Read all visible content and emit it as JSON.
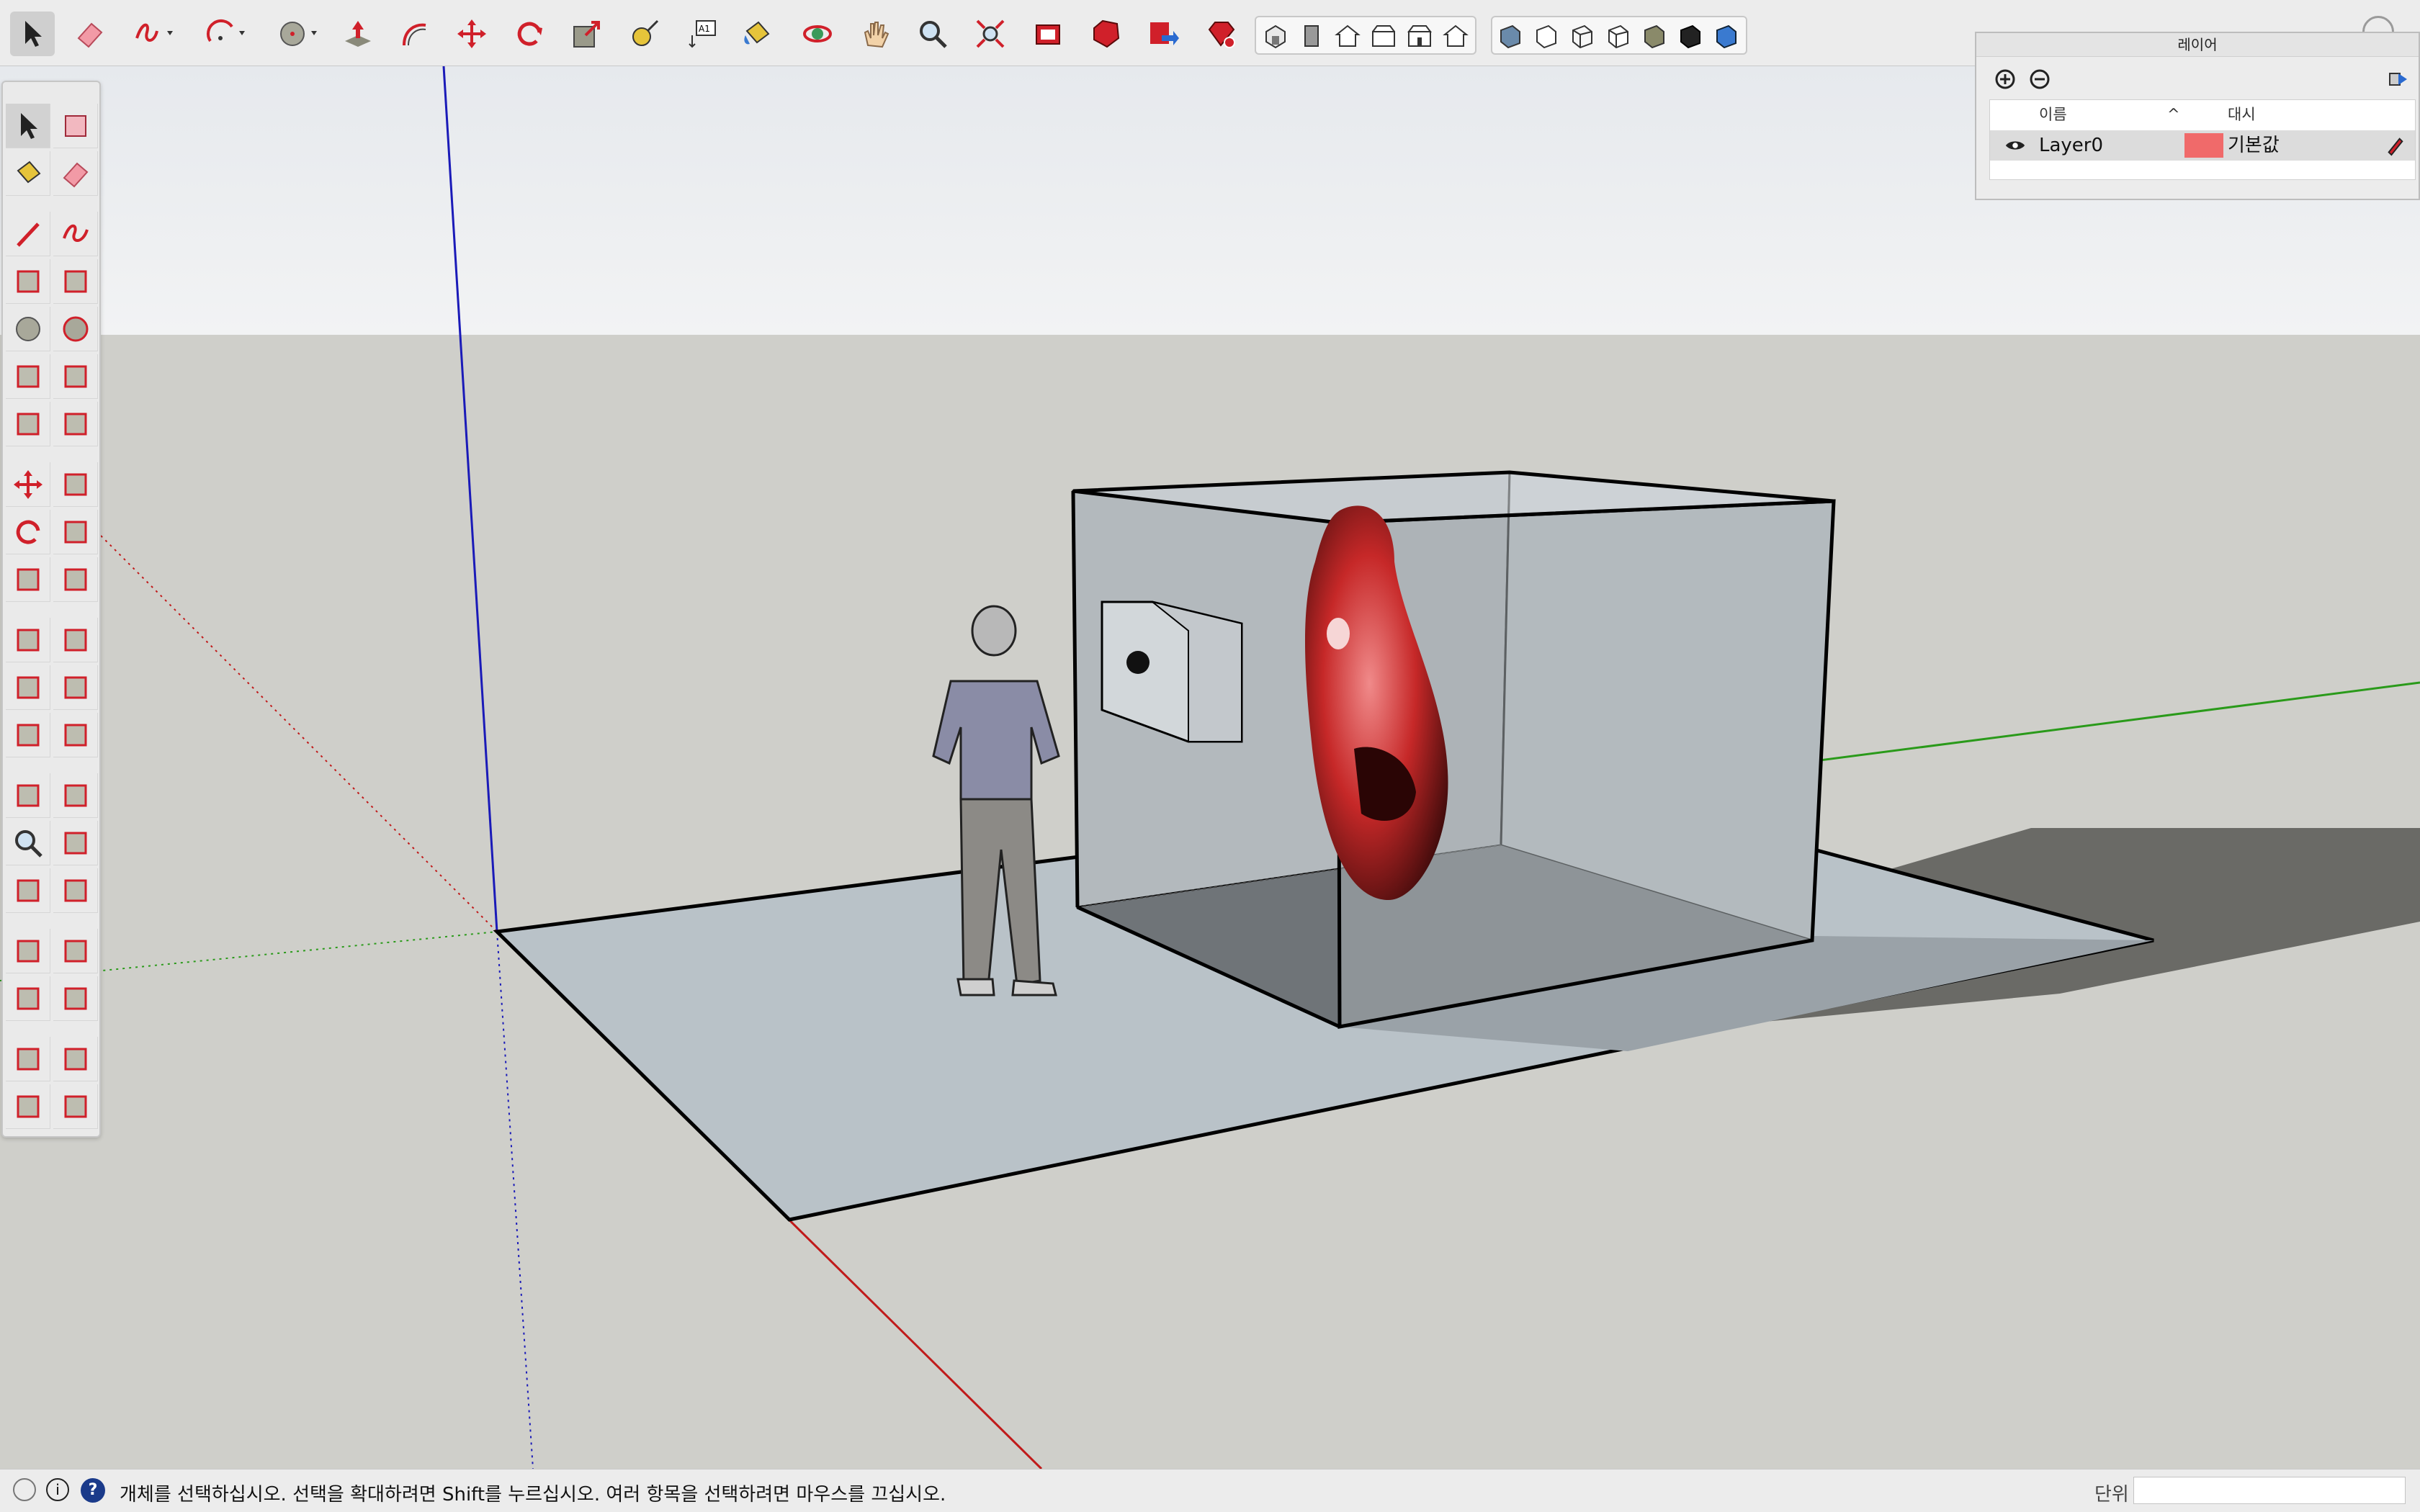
{
  "toolbar": {
    "items": [
      {
        "name": "select-tool",
        "icon": "arrow-cursor-icon",
        "active": true
      },
      {
        "name": "eraser-tool",
        "icon": "eraser-icon"
      },
      {
        "name": "freehand-tool",
        "icon": "freehand-squiggle-icon",
        "dropdown": true
      },
      {
        "name": "arc-tool",
        "icon": "arc-icon",
        "dropdown": true
      },
      {
        "name": "circle-tool",
        "icon": "circle-icon",
        "dropdown": true
      },
      {
        "name": "push-pull-tool",
        "icon": "push-pull-icon"
      },
      {
        "name": "offset-tool",
        "icon": "offset-icon"
      },
      {
        "name": "move-tool",
        "icon": "move-arrows-icon"
      },
      {
        "name": "rotate-tool",
        "icon": "rotate-icon"
      },
      {
        "name": "scale-tool",
        "icon": "scale-icon"
      },
      {
        "name": "tape-measure-tool",
        "icon": "tape-measure-icon"
      },
      {
        "name": "text-tool",
        "icon": "text-label-icon"
      },
      {
        "name": "paint-bucket-tool",
        "icon": "paint-bucket-icon"
      },
      {
        "name": "orbit-tool",
        "icon": "orbit-icon"
      },
      {
        "name": "pan-tool",
        "icon": "hand-icon"
      },
      {
        "name": "zoom-tool",
        "icon": "magnifier-icon"
      },
      {
        "name": "zoom-extents-tool",
        "icon": "zoom-extents-icon"
      },
      {
        "name": "3d-warehouse-button",
        "icon": "warehouse-icon"
      },
      {
        "name": "extension-warehouse-button",
        "icon": "extension-gem-icon"
      },
      {
        "name": "send-to-layout-button",
        "icon": "send-to-layout-icon"
      },
      {
        "name": "extension-manager-button",
        "icon": "ruby-gem-icon"
      }
    ],
    "views": [
      "iso-view-icon",
      "top-view-icon",
      "front-view-icon",
      "right-view-icon",
      "back-view-icon",
      "left-view-icon"
    ],
    "styles": [
      "xray-style-icon",
      "back-edges-style-icon",
      "wireframe-style-icon",
      "hidden-line-style-icon",
      "shaded-style-icon",
      "shaded-textures-style-icon",
      "monochrome-style-icon"
    ]
  },
  "tooltray": {
    "items": [
      "select-icon",
      "make-component-icon",
      "paint-bucket-icon",
      "eraser-icon",
      "line-icon",
      "freehand-icon",
      "rectangle-icon",
      "rotated-rectangle-icon",
      "circle-icon",
      "polygon-icon",
      "arc-icon",
      "two-point-arc-icon",
      "three-point-arc-icon",
      "pie-icon",
      "move-icon",
      "push-pull-icon",
      "rotate-icon",
      "follow-me-icon",
      "scale-icon",
      "offset-icon",
      "tape-measure-icon",
      "dimension-icon",
      "protractor-icon",
      "text-icon",
      "axes-icon",
      "3d-text-icon",
      "orbit-icon",
      "pan-icon",
      "zoom-icon",
      "zoom-window-icon",
      "zoom-extents-icon",
      "previous-view-icon",
      "position-camera-icon",
      "walk-icon",
      "look-around-icon",
      "section-plane-icon",
      "warehouse-icon",
      "extension-warehouse-icon",
      "send-to-layout-icon",
      "extension-manager-icon"
    ]
  },
  "layers": {
    "title": "레이어",
    "add_icon": "add-layer-icon",
    "remove_icon": "remove-layer-icon",
    "details_icon": "details-arrow-icon",
    "col_name": "이름",
    "col_dash": "대시",
    "rows": [
      {
        "name": "Layer0",
        "color": "#f06a6a",
        "dash": "기본값",
        "visible": true
      }
    ]
  },
  "scene": {
    "figure_label": "scale-figure",
    "model": "glass-box-with-red-face"
  },
  "statusbar": {
    "icons": [
      "geo-location-icon",
      "credits-icon",
      "help-icon"
    ],
    "text": "개체를 선택하십시오. 선택을 확대하려면 Shift를 누르십시오. 여러 항목을 선택하려면 마우스를 끄십시오.",
    "units_label": "단위",
    "units_value": ""
  },
  "colors": {
    "accent_red": "#d0202a",
    "axis_blue": "#1a1ab8",
    "axis_green": "#2a9a1a",
    "axis_red": "#c01a1a",
    "sky": "#eef0f2",
    "ground": "#cfcfca"
  }
}
